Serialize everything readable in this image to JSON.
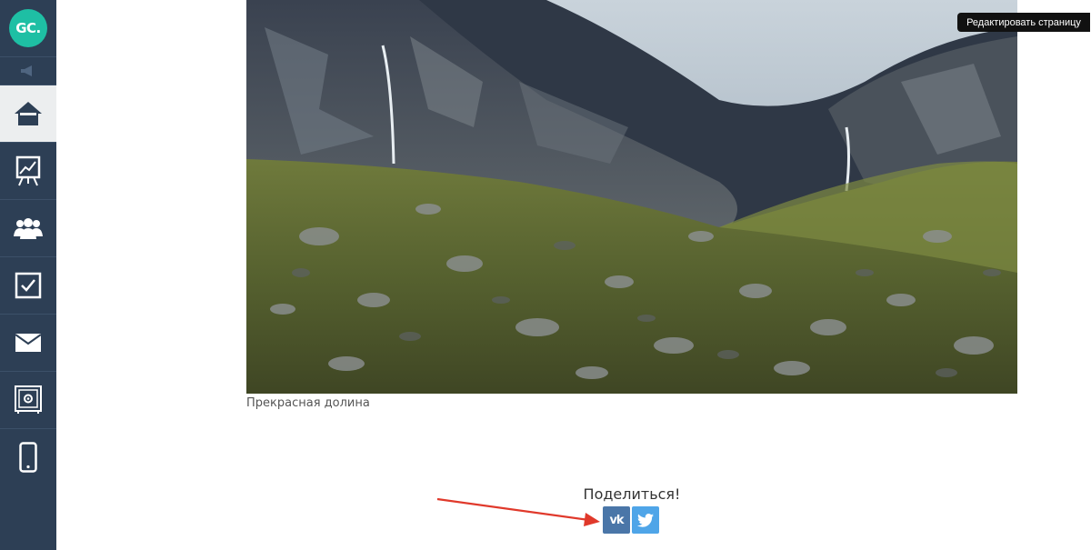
{
  "sidebar": {
    "logo_text": "GC.",
    "items": [
      {
        "name": "home-icon"
      },
      {
        "name": "chart-board-icon"
      },
      {
        "name": "users-icon"
      },
      {
        "name": "tasks-checkbox-icon"
      },
      {
        "name": "mail-icon"
      },
      {
        "name": "safe-icon"
      },
      {
        "name": "mobile-icon"
      }
    ],
    "colors": {
      "background": "#2d3f55",
      "active": "#eceeef",
      "logo": "#1ebfa4"
    }
  },
  "toolbar": {
    "edit_page_label": "Редактировать страницу"
  },
  "content": {
    "image_caption": "Прекрасная долина"
  },
  "share": {
    "title": "Поделиться!",
    "vk_label": "vk",
    "buttons": [
      {
        "name": "vk-icon",
        "color": "#4a76a8"
      },
      {
        "name": "twitter-icon",
        "color": "#4fa5e8"
      }
    ]
  }
}
